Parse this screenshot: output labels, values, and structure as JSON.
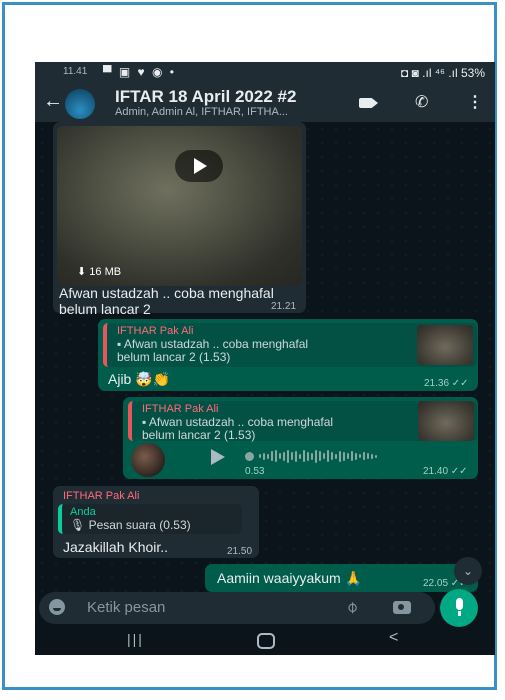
{
  "status_bar": {
    "time": "11.41",
    "notification_icons": "▀ ▣ ♥ ◉ •",
    "right_icons": "◘ ◙ .ıl ⁴⁶ .ıl",
    "battery": "53%"
  },
  "header": {
    "back_icon": "arrow-left-icon",
    "title": "IFTAR 18 April 2022 #2",
    "subtitle": "Admin, Admin Al, IFTHAR, IFTHA..."
  },
  "messages": [
    {
      "type": "incoming-video",
      "file_size": "16 MB",
      "text_line1": "Afwan ustadzah .. coba menghafal",
      "text_line2": "belum lancar 2",
      "time": "21.21"
    },
    {
      "type": "outgoing-reply",
      "quoted_sender": "IFTHAR Pak Ali",
      "quoted_line1": "▪ Afwan ustadzah .. coba menghafal",
      "quoted_line2": "belum lancar 2 (1.53)",
      "text": "Ajib 🤯👏",
      "time": "21.36 ✓✓"
    },
    {
      "type": "outgoing-voice-reply",
      "quoted_sender": "IFTHAR Pak Ali",
      "quoted_line1": "▪ Afwan ustadzah .. coba menghafal",
      "quoted_line2": "belum lancar 2 (1.53)",
      "duration": "0.53",
      "time": "21.40 ✓✓"
    },
    {
      "type": "incoming-reply",
      "sender": "IFTHAR Pak Ali",
      "quoted_sender": "Anda",
      "quoted_text": "🎙 Pesan suara (0.53)",
      "text": "Jazakillah Khoir..",
      "time": "21.50"
    },
    {
      "type": "outgoing",
      "text": "Aamiin waaiyyakum 🙏",
      "time": "22.05 ✓✓"
    }
  ],
  "input": {
    "placeholder": "Ketik pesan"
  },
  "colors": {
    "header_bg": "#1f2c33",
    "chat_bg": "#0b141a",
    "outgoing_bubble": "#005c4b",
    "incoming_bubble": "#202c33",
    "accent": "#00a884",
    "frame_border": "#3a8fc8"
  },
  "icons": [
    "arrow-left-icon",
    "video-call-icon",
    "phone-icon",
    "more-icon",
    "play-icon",
    "download-icon",
    "emoji-icon",
    "attach-icon",
    "camera-icon",
    "mic-icon",
    "chevron-down-icon"
  ]
}
